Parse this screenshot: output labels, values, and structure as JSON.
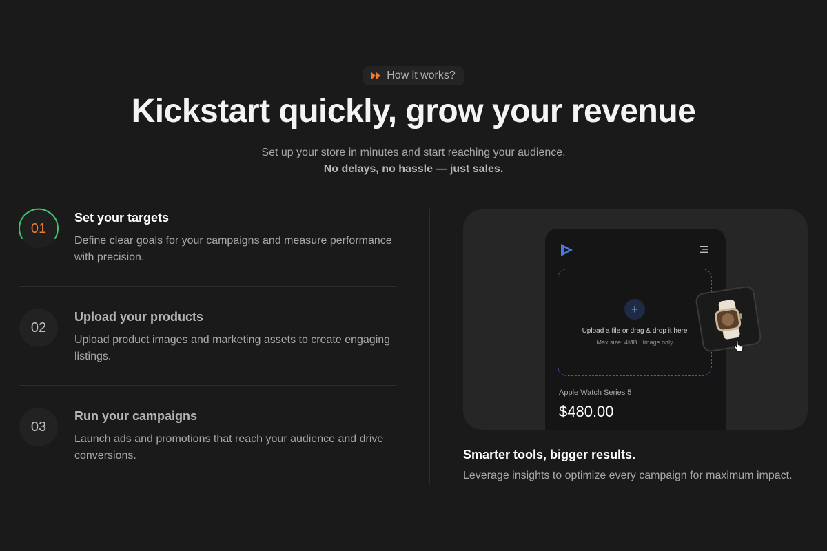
{
  "badge": {
    "icon": "fast-forward-icon",
    "label": "How it works?"
  },
  "hero": {
    "title": "Kickstart quickly, grow your revenue",
    "subtitle": "Set up your store in minutes and start reaching your audience.",
    "subtitle_emphasis": "No delays, no hassle — just sales."
  },
  "steps": [
    {
      "number": "01",
      "title": "Set your targets",
      "description": "Define clear goals for your campaigns and measure performance with precision.",
      "active": true
    },
    {
      "number": "02",
      "title": "Upload your products",
      "description": "Upload product images and marketing assets to create engaging listings.",
      "active": false
    },
    {
      "number": "03",
      "title": "Run your campaigns",
      "description": "Launch ads and promotions that reach your audience and drive conversions.",
      "active": false
    }
  ],
  "preview": {
    "upload_text": "Upload a file or drag & drop it here",
    "upload_hint": "Max size: 4MB · Image only",
    "product_name": "Apple Watch Series 5",
    "price": "$480.00"
  },
  "feature": {
    "title": "Smarter tools, bigger results.",
    "description": "Leverage insights to optimize every campaign for maximum impact."
  },
  "colors": {
    "accent": "#f07a2c",
    "active_ring": "#3ec46d",
    "upload_border": "#3a64a8",
    "background": "#1a1a1a"
  }
}
